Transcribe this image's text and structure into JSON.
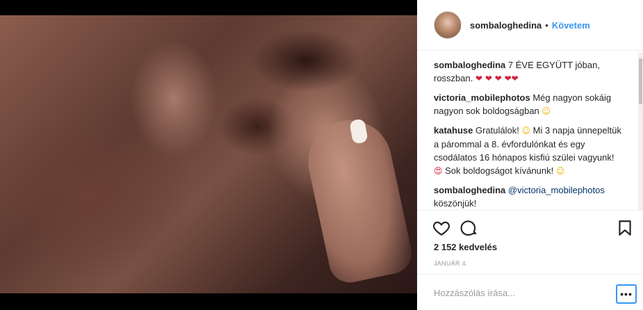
{
  "post": {
    "username": "sombaloghedina",
    "follow_label": "Követem",
    "separator": "•"
  },
  "comments": [
    {
      "user": "sombaloghedina",
      "text": "7 ÉVE EGYÜTT jóban, rosszban.",
      "emoji": "❤ ❤ ❤ ❤❤"
    },
    {
      "user": "victoria_mobilephotos",
      "text": "Még nagyon sokáig nagyon sok boldogságban",
      "emoji": "☺"
    },
    {
      "user": "katahuse",
      "text": "Gratulálok!",
      "emoji": "☺",
      "text2": "Mi 3 napja ünnepeltük a párommal a 8. évfordulónkat és egy csodálatos 16 hónapos kisfiú szülei vagyunk!",
      "emoji2": "😍",
      "text3": "Sok boldogságot kívánunk!",
      "emoji3": "☺"
    },
    {
      "user": "sombaloghedina",
      "mention": "@victoria_mobilephotos",
      "text": "köszönjük!"
    }
  ],
  "likes": "2 152 kedvelés",
  "date": "JANUÁR 4.",
  "comment_input": {
    "placeholder": "Hozzászólás írása..."
  },
  "more_label": "•••",
  "icons": [
    "heart-icon",
    "comment-icon",
    "bookmark-icon",
    "more-options-icon"
  ],
  "colors": {
    "accent": "#3897f0",
    "heart": "#d4213a"
  }
}
